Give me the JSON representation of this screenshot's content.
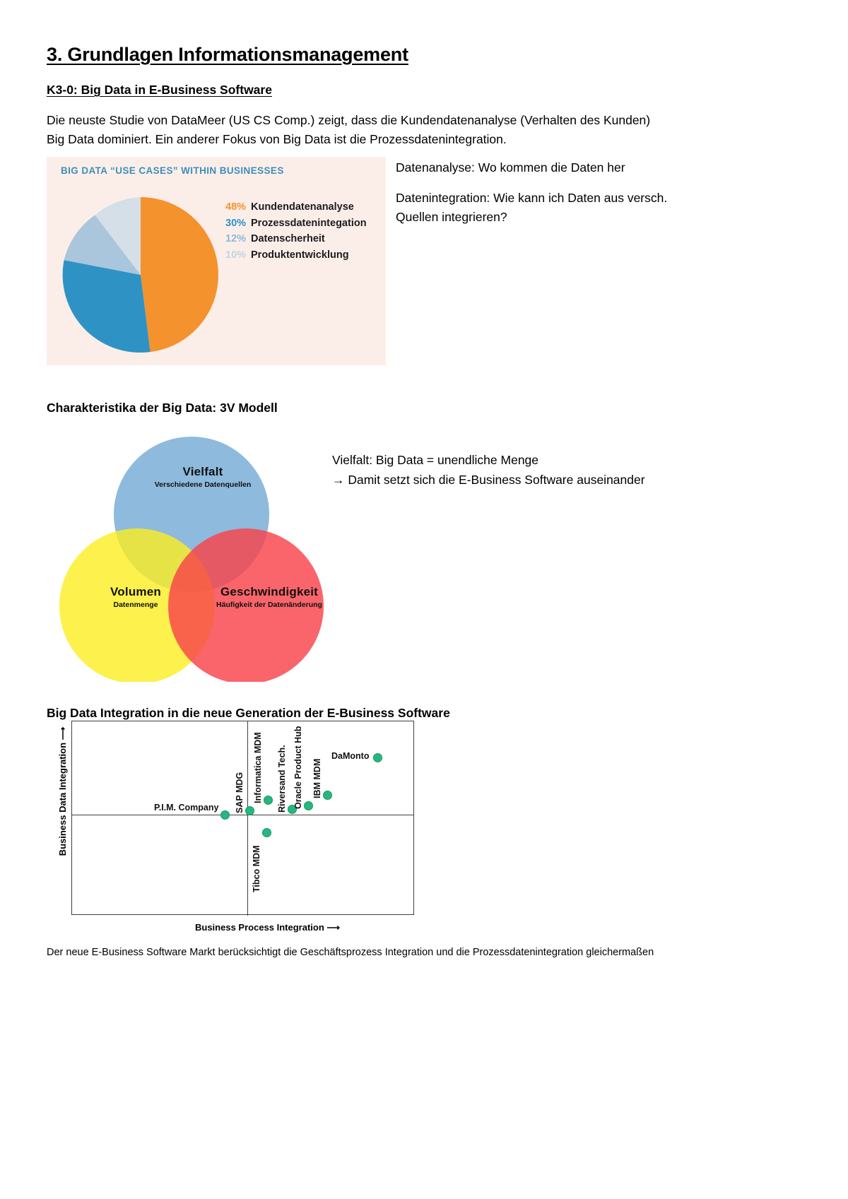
{
  "document": {
    "title": "3. Grundlagen Informationsmanagement",
    "section_heading": "K3-0: Big Data in E-Business Software",
    "intro_paragraph": "Die neuste Studie von DataMeer (US CS Comp.) zeigt, dass die Kundendatenanalyse (Verhalten des Kunden) Big Data dominiert. Ein anderer Fokus von Big Data ist die Prozessdatenintegration.",
    "notes": {
      "datenanalyse": "Datenanalyse: Wo kommen die Daten her",
      "datenintegration": "Datenintegration: Wie kann ich Daten aus versch. Quellen integrieren?"
    },
    "venn_heading": "Charakteristika der Big Data: 3V Modell",
    "venn_notes": {
      "line1": "Vielfalt: Big Data = unendliche Menge",
      "line2": "→ Damit setzt sich die E-Business Software auseinander"
    },
    "quad_heading": "Big Data Integration in die neue Generation der E-Business Software",
    "footer": "Der neue E-Business Software Markt berücksichtigt die Geschäftsprozess Integration und die Prozessdatenintegration gleichermaßen"
  },
  "chart_data": [
    {
      "type": "pie",
      "title": "BIG DATA “USE CASES” WITHIN BUSINESSES",
      "title_color": "#3d8fba",
      "background": "#fbeee9",
      "legend_position": "right",
      "categories": [
        "Kundendatenanalyse",
        "Prozessdatenintegation",
        "Datenscherheit",
        "Produktentwicklung"
      ],
      "values": [
        48,
        30,
        12,
        10
      ],
      "value_labels": [
        "48%",
        "30%",
        "12%",
        "10%"
      ],
      "colors": [
        "#f4922e",
        "#2e93c4",
        "#a9c6dc",
        "#d4dfe7"
      ]
    },
    {
      "type": "venn",
      "title": "Charakteristika der Big Data: 3V Modell",
      "sets": [
        {
          "name": "Vielfalt",
          "subtitle": "Verschiedene Datenquellen",
          "color": "#7eb0d8"
        },
        {
          "name": "Volumen",
          "subtitle": "Datenmenge",
          "color": "#fdee21"
        },
        {
          "name": "Geschwindigkeit",
          "subtitle": "Häufigkeit der Datenänderung",
          "color": "#f8434a"
        }
      ]
    },
    {
      "type": "scatter",
      "title": "Big Data Integration in die neue Generation der E-Business Software",
      "xlabel": "Business Process Integration ⟶",
      "ylabel": "Business Data Integration ⟶",
      "xlim": [
        0,
        100
      ],
      "ylim": [
        0,
        100
      ],
      "grid": false,
      "quadrant_lines": {
        "x": 44,
        "y": 52
      },
      "marker_color": "#28b67e",
      "points": [
        {
          "label": "P.I.M.  Company",
          "x": 43.5,
          "y": 51.0,
          "label_orient": "horizontal-left"
        },
        {
          "label": "SAP MDG",
          "x": 51.0,
          "y": 56.0,
          "label_orient": "vertical"
        },
        {
          "label": "Informatica MDM",
          "x": 56.5,
          "y": 62.5,
          "label_orient": "vertical"
        },
        {
          "label": "Riversand Tech.",
          "x": 67.0,
          "y": 57.5,
          "label_orient": "vertical"
        },
        {
          "label": "Oracle Product Hub",
          "x": 74.5,
          "y": 60.0,
          "label_orient": "vertical"
        },
        {
          "label": "IBM MDM",
          "x": 83.0,
          "y": 66.0,
          "label_orient": "vertical"
        },
        {
          "label": "DaMonto",
          "x": 94.5,
          "y": 84.0,
          "label_orient": "horizontal-left"
        },
        {
          "label": "Tibco MDM",
          "x": 56.0,
          "y": 42.0,
          "label_orient": "vertical-down"
        }
      ]
    }
  ]
}
